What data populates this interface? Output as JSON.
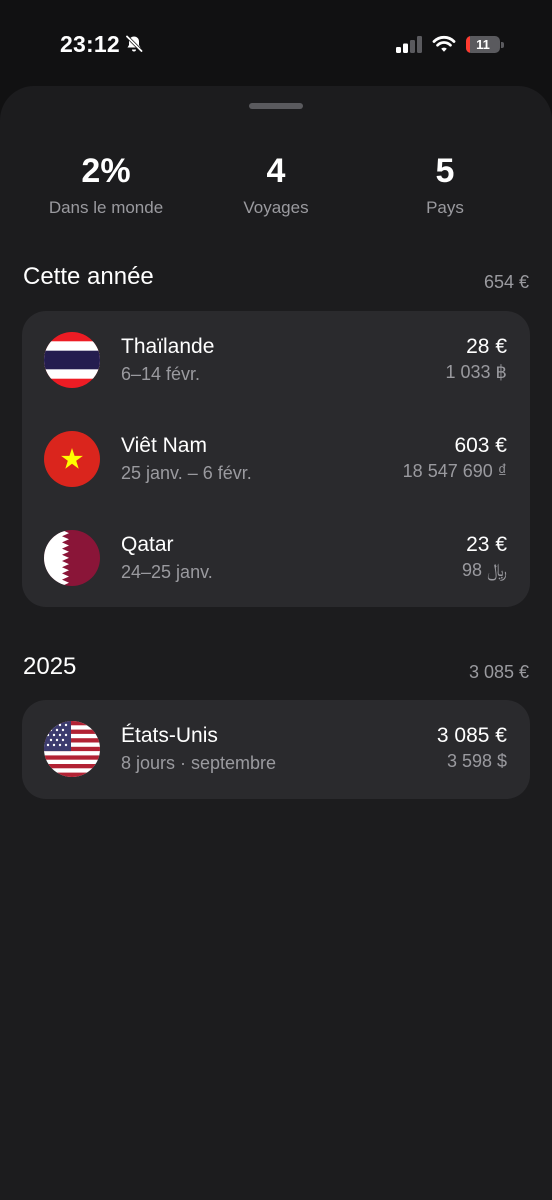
{
  "status_bar": {
    "time": "23:12",
    "battery_percent": "11",
    "battery_level": 0.11
  },
  "stats": [
    {
      "value": "2%",
      "label": "Dans le monde"
    },
    {
      "value": "4",
      "label": "Voyages"
    },
    {
      "value": "5",
      "label": "Pays"
    }
  ],
  "sections": [
    {
      "title": "Cette année",
      "total": "654 €",
      "trips": [
        {
          "country": "Thaïlande",
          "dates": "6–14 févr.",
          "amount": "28 €",
          "local_amount": "1 033 ฿",
          "flag": "thailand-flag-icon"
        },
        {
          "country": "Viêt Nam",
          "dates": "25 janv. – 6 févr.",
          "amount": "603 €",
          "local_amount": "18 547 690 ₫",
          "flag": "vietnam-flag-icon"
        },
        {
          "country": "Qatar",
          "dates": "24–25 janv.",
          "amount": "23 €",
          "local_amount": "98 ﷼",
          "flag": "qatar-flag-icon"
        }
      ]
    },
    {
      "title": "2025",
      "total": "3 085 €",
      "trips": [
        {
          "country": "États-Unis",
          "dates": "8 jours · septembre",
          "amount": "3 085 €",
          "local_amount": "3 598 $",
          "flag": "usa-flag-icon"
        }
      ]
    }
  ],
  "colors": {
    "background": "#111112",
    "sheet": "#1c1c1e",
    "card": "#2a2a2d",
    "secondary_text": "#9a9a9f",
    "battery_low": "#ff3b30"
  }
}
